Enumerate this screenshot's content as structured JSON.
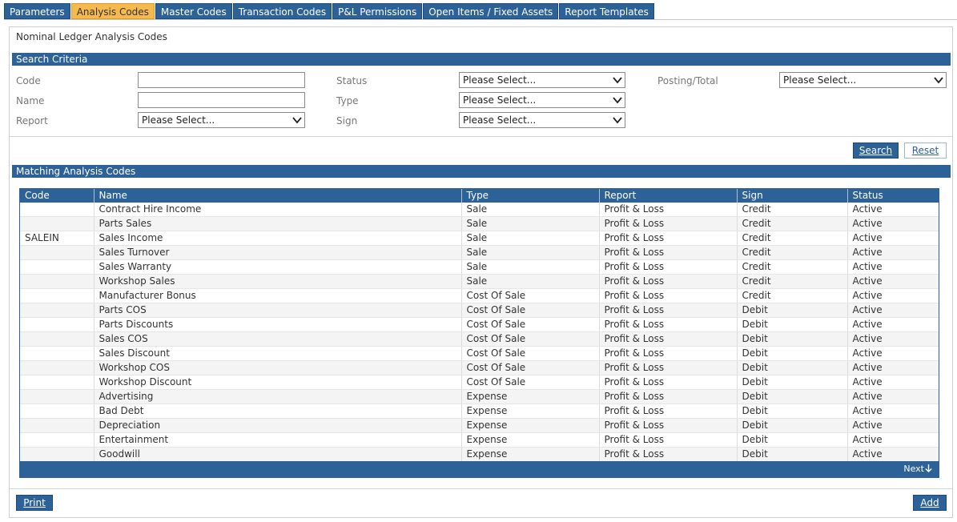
{
  "tabs": [
    {
      "label": "Parameters",
      "active": false
    },
    {
      "label": "Analysis Codes",
      "active": true
    },
    {
      "label": "Master Codes",
      "active": false
    },
    {
      "label": "Transaction Codes",
      "active": false
    },
    {
      "label": "P&L Permissions",
      "active": false
    },
    {
      "label": "Open Items / Fixed Assets",
      "active": false
    },
    {
      "label": "Report Templates",
      "active": false
    }
  ],
  "page_title": "Nominal Ledger Analysis Codes",
  "search": {
    "header": "Search Criteria",
    "code_label": "Code",
    "code_value": "",
    "name_label": "Name",
    "name_value": "",
    "report_label": "Report",
    "report_value": "Please Select...",
    "status_label": "Status",
    "status_value": "Please Select...",
    "type_label": "Type",
    "type_value": "Please Select...",
    "sign_label": "Sign",
    "sign_value": "Please Select...",
    "posting_label": "Posting/Total",
    "posting_value": "Please Select...",
    "search_button": "Search",
    "reset_button": "Reset"
  },
  "results": {
    "header": "Matching Analysis Codes",
    "columns": [
      "Code",
      "Name",
      "Type",
      "Report",
      "Sign",
      "Status"
    ],
    "rows": [
      [
        "",
        "Contract Hire Income",
        "Sale",
        "Profit & Loss",
        "Credit",
        "Active"
      ],
      [
        "",
        "Parts Sales",
        "Sale",
        "Profit & Loss",
        "Credit",
        "Active"
      ],
      [
        "SALEIN",
        "Sales Income",
        "Sale",
        "Profit & Loss",
        "Credit",
        "Active"
      ],
      [
        "",
        "Sales Turnover",
        "Sale",
        "Profit & Loss",
        "Credit",
        "Active"
      ],
      [
        "",
        "Sales Warranty",
        "Sale",
        "Profit & Loss",
        "Credit",
        "Active"
      ],
      [
        "",
        "Workshop Sales",
        "Sale",
        "Profit & Loss",
        "Credit",
        "Active"
      ],
      [
        "",
        "Manufacturer Bonus",
        "Cost Of Sale",
        "Profit & Loss",
        "Credit",
        "Active"
      ],
      [
        "",
        "Parts COS",
        "Cost Of Sale",
        "Profit & Loss",
        "Debit",
        "Active"
      ],
      [
        "",
        "Parts Discounts",
        "Cost Of Sale",
        "Profit & Loss",
        "Debit",
        "Active"
      ],
      [
        "",
        "Sales COS",
        "Cost Of Sale",
        "Profit & Loss",
        "Debit",
        "Active"
      ],
      [
        "",
        "Sales Discount",
        "Cost Of Sale",
        "Profit & Loss",
        "Debit",
        "Active"
      ],
      [
        "",
        "Workshop COS",
        "Cost Of Sale",
        "Profit & Loss",
        "Debit",
        "Active"
      ],
      [
        "",
        "Workshop Discount",
        "Cost Of Sale",
        "Profit & Loss",
        "Debit",
        "Active"
      ],
      [
        "",
        "Advertising",
        "Expense",
        "Profit & Loss",
        "Debit",
        "Active"
      ],
      [
        "",
        "Bad Debt",
        "Expense",
        "Profit & Loss",
        "Debit",
        "Active"
      ],
      [
        "",
        "Depreciation",
        "Expense",
        "Profit & Loss",
        "Debit",
        "Active"
      ],
      [
        "",
        "Entertainment",
        "Expense",
        "Profit & Loss",
        "Debit",
        "Active"
      ],
      [
        "",
        "Goodwill",
        "Expense",
        "Profit & Loss",
        "Debit",
        "Active"
      ]
    ],
    "next_label": "Next"
  },
  "footer": {
    "print_button": "Print",
    "add_button": "Add"
  },
  "colors": {
    "primary": "#2d6298",
    "active_tab": "#f6b94c"
  }
}
